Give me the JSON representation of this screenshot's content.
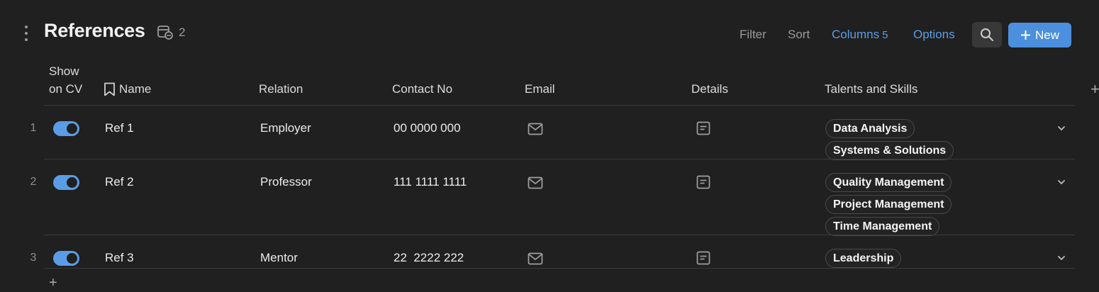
{
  "header": {
    "title": "References",
    "row_count": "2",
    "filter_label": "Filter",
    "sort_label": "Sort",
    "columns_label": "Columns",
    "columns_count": "5",
    "options_label": "Options",
    "new_label": "New",
    "accent_color": "#4b8fde"
  },
  "table": {
    "columns": {
      "show_on_cv_line1": "Show",
      "show_on_cv_line2": "on CV",
      "name": "Name",
      "relation": "Relation",
      "contact": "Contact No",
      "email": "Email",
      "details": "Details",
      "skills": "Talents and Skills"
    },
    "rows": [
      {
        "num": "1",
        "show_on_cv": true,
        "name": "Ref 1",
        "relation": "Employer",
        "contact": "00 0000 000",
        "skills": [
          "Data Analysis",
          "Systems & Solutions"
        ]
      },
      {
        "num": "2",
        "show_on_cv": true,
        "name": "Ref 2",
        "relation": "Professor",
        "contact": "111 1111 1111",
        "skills": [
          "Quality Management",
          "Project Management",
          "Time Management"
        ]
      },
      {
        "num": "3",
        "show_on_cv": true,
        "name": "Ref 3",
        "relation": "Mentor",
        "contact": "22  2222 222",
        "skills": [
          "Leadership"
        ]
      }
    ]
  },
  "icons": {
    "menu": "kebab-icon",
    "database": "database-icon",
    "search": "search-icon",
    "plus": "plus-icon",
    "email": "mail-icon",
    "details": "note-icon",
    "expand": "chevron-down-icon",
    "name_column": "bookmark-icon"
  }
}
